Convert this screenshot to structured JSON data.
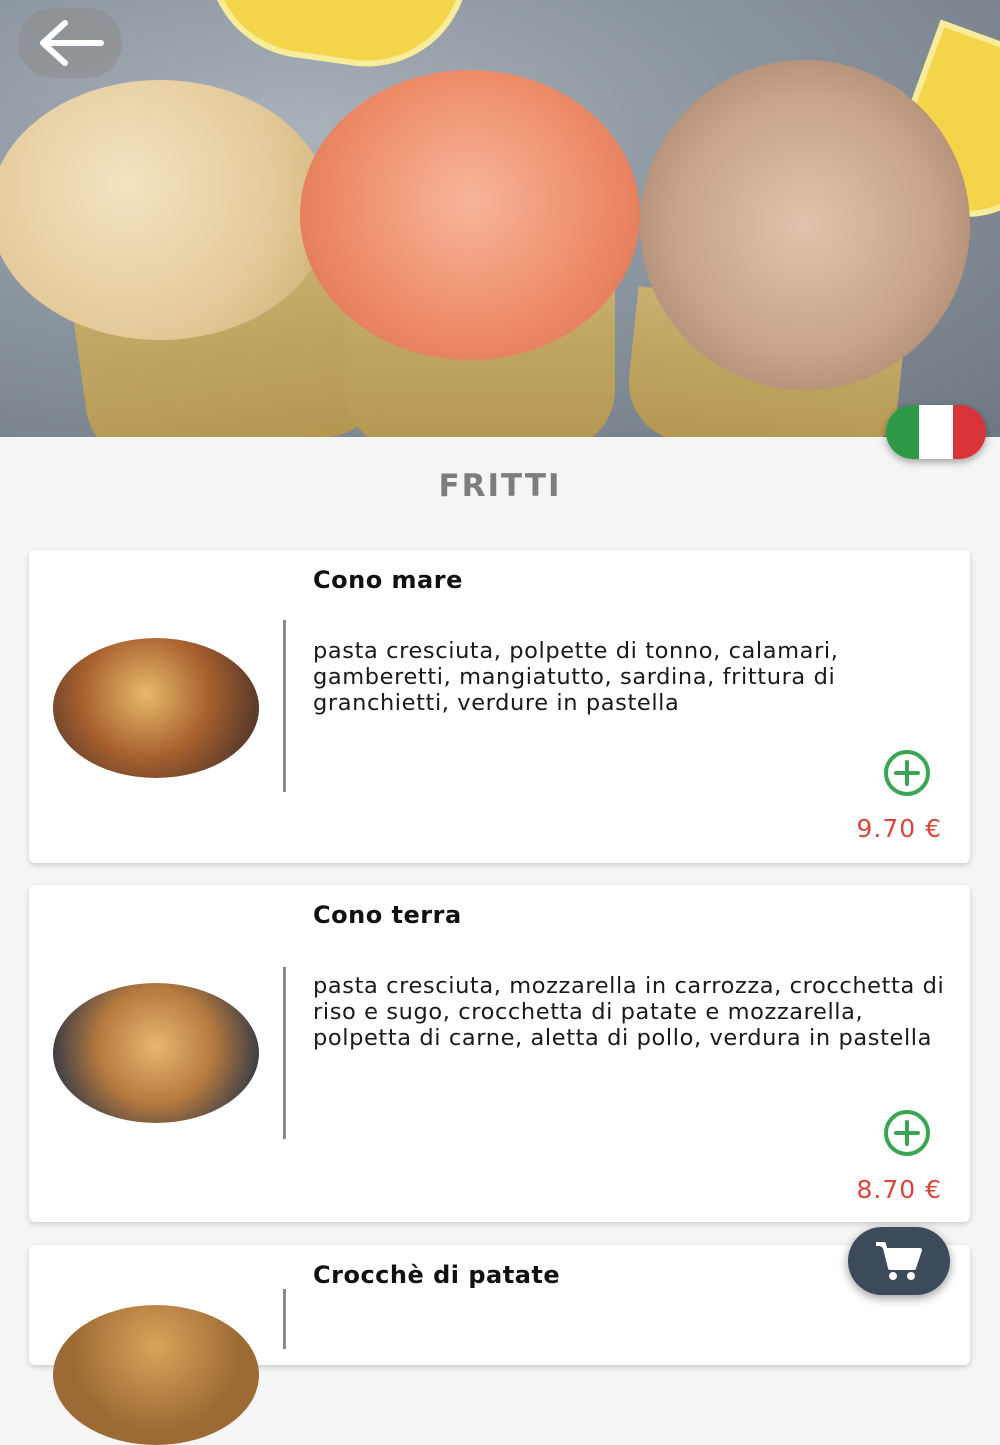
{
  "hero": {
    "image": "fried seafood cones photo"
  },
  "icons": {
    "back": "arrow-left-icon",
    "cart": "shopping-cart-icon",
    "add": "plus-circle-icon",
    "language": "italian-flag-icon"
  },
  "section": {
    "title": "FRITTI"
  },
  "items": [
    {
      "name": "Cono mare",
      "description": "pasta cresciuta, polpette di tonno, calamari, gamberetti, mangiatutto, sardina, frittura di granchietti, verdure in pastella",
      "price": "9.70 €"
    },
    {
      "name": "Cono terra",
      "description": "pasta cresciuta, mozzarella in carrozza, crocchetta di riso e sugo, crocchetta di patate e mozzarella, polpetta di carne, aletta di pollo, verdura in pastella",
      "price": "8.70 €"
    },
    {
      "name": "Crocchè di patate",
      "description": "",
      "price": ""
    }
  ],
  "colors": {
    "price": "#d9473c",
    "add": "#3aa655",
    "cart_bg": "#3d4a5a"
  }
}
